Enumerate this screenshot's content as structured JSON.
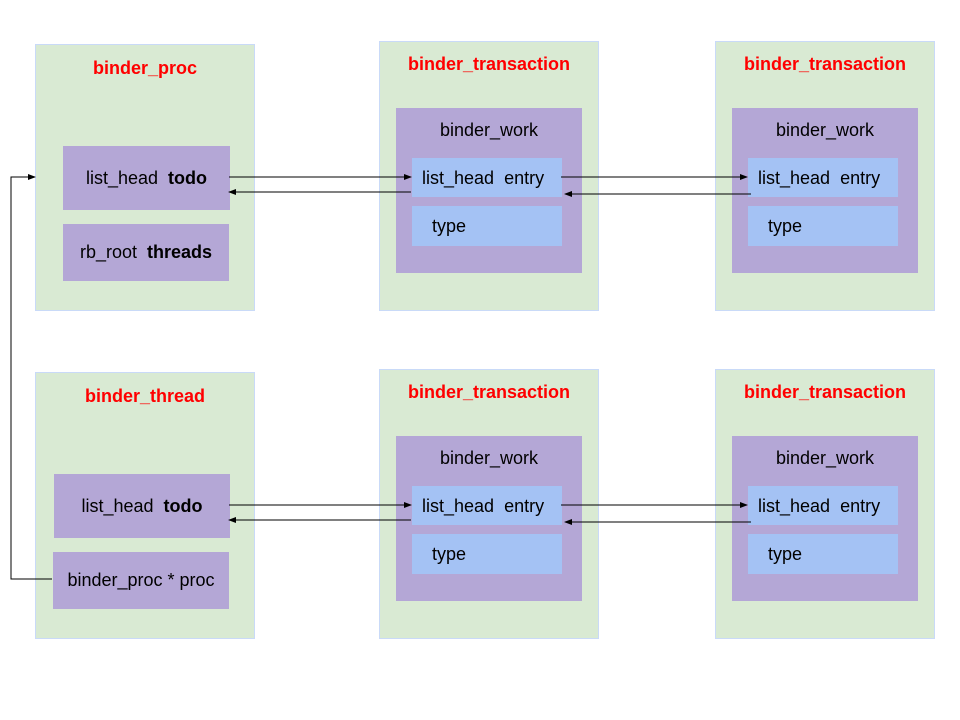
{
  "colors": {
    "container_bg": "#d9ead3",
    "container_border": "#c9daf8",
    "title": "#ff0000",
    "struct_bg": "#b4a7d6",
    "field_bg": "#a4c2f4",
    "line": "#000000"
  },
  "binder_proc": {
    "title": "binder_proc",
    "fields": [
      {
        "type": "list_head",
        "name": "todo"
      },
      {
        "type": "rb_root",
        "name": "threads"
      }
    ]
  },
  "binder_thread": {
    "title": "binder_thread",
    "fields": [
      {
        "type": "list_head",
        "name": "todo"
      },
      {
        "text": "binder_proc * proc"
      }
    ]
  },
  "transactions": [
    {
      "title": "binder_transaction",
      "work_label": "binder_work",
      "entry": {
        "type": "list_head",
        "name": "entry"
      },
      "type_field": "type"
    },
    {
      "title": "binder_transaction",
      "work_label": "binder_work",
      "entry": {
        "type": "list_head",
        "name": "entry"
      },
      "type_field": "type"
    },
    {
      "title": "binder_transaction",
      "work_label": "binder_work",
      "entry": {
        "type": "list_head",
        "name": "entry"
      },
      "type_field": "type"
    },
    {
      "title": "binder_transaction",
      "work_label": "binder_work",
      "entry": {
        "type": "list_head",
        "name": "entry"
      },
      "type_field": "type"
    }
  ],
  "links": [
    {
      "from": "binder_proc.todo",
      "to": "transactions.0.entry",
      "kind": "next"
    },
    {
      "from": "transactions.0.entry",
      "to": "binder_proc.todo",
      "kind": "prev"
    },
    {
      "from": "transactions.0.entry",
      "to": "transactions.1.entry",
      "kind": "next"
    },
    {
      "from": "transactions.1.entry",
      "to": "transactions.0.entry",
      "kind": "prev"
    },
    {
      "from": "binder_thread.todo",
      "to": "transactions.2.entry",
      "kind": "next"
    },
    {
      "from": "transactions.2.entry",
      "to": "binder_thread.todo",
      "kind": "prev"
    },
    {
      "from": "transactions.2.entry",
      "to": "transactions.3.entry",
      "kind": "next"
    },
    {
      "from": "transactions.3.entry",
      "to": "transactions.2.entry",
      "kind": "prev"
    },
    {
      "from": "binder_thread.proc",
      "to": "binder_proc",
      "kind": "pointer"
    }
  ]
}
